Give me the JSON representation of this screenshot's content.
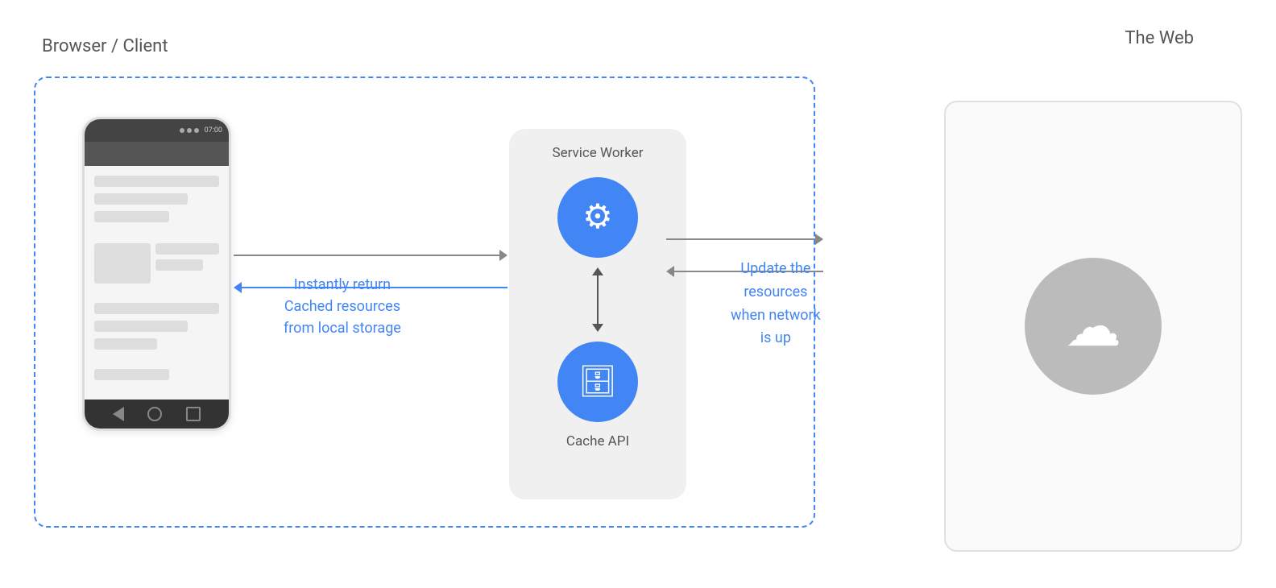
{
  "labels": {
    "browser_client": "Browser / Client",
    "the_web": "The Web",
    "service_worker": "Service Worker",
    "cache_api": "Cache API",
    "instantly_return": "Instantly return",
    "cached_resources": "Cached resources",
    "from_local_storage": "from local storage",
    "update_the": "Update the",
    "resources": "resources",
    "when_network": "when network",
    "is_up": "is up"
  },
  "colors": {
    "blue": "#4285F4",
    "text_gray": "#555555",
    "arrow_gray": "#888888",
    "dashed_border": "#4285F4"
  }
}
